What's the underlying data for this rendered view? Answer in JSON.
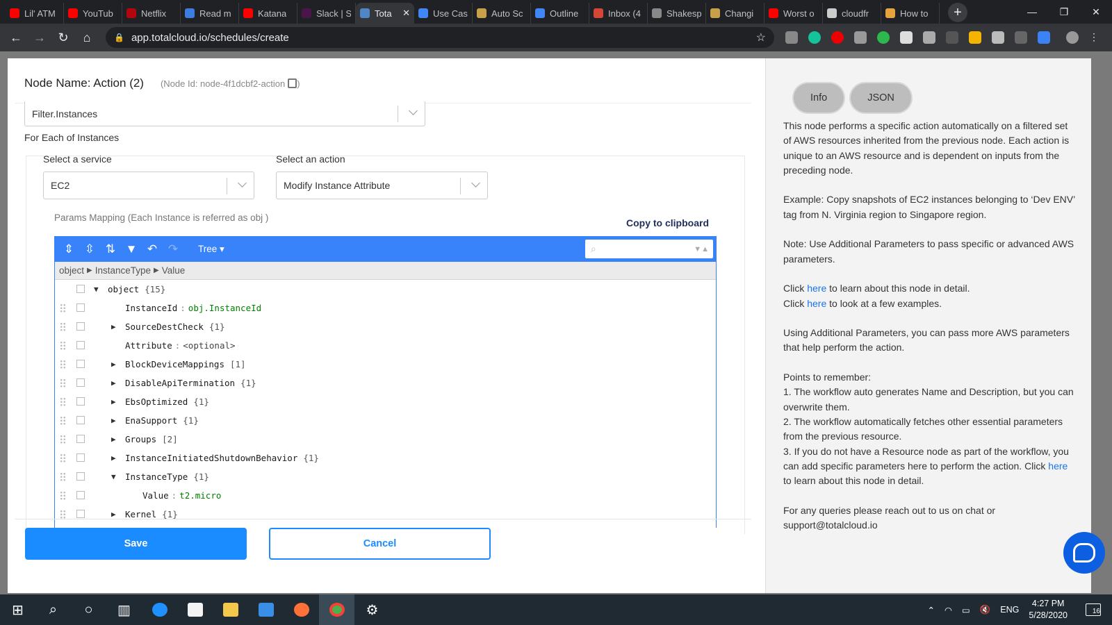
{
  "browser": {
    "tabs": [
      {
        "title": "Lil' ATM",
        "color": "#ff0000"
      },
      {
        "title": "YouTub",
        "color": "#ff0000"
      },
      {
        "title": "Netflix",
        "color": "#b1060f"
      },
      {
        "title": "Read m",
        "color": "#3d7de0"
      },
      {
        "title": "Katana",
        "color": "#ff0000"
      },
      {
        "title": "Slack | S",
        "color": "#4a154b"
      },
      {
        "title": "Tota",
        "color": "#4f86c6",
        "active": true
      },
      {
        "title": "Use Cas",
        "color": "#4285f4"
      },
      {
        "title": "Auto Sc",
        "color": "#c8a04a"
      },
      {
        "title": "Outline",
        "color": "#4285f4"
      },
      {
        "title": "Inbox (4",
        "color": "#d44638"
      },
      {
        "title": "Shakesp",
        "color": "#888888"
      },
      {
        "title": "Changi",
        "color": "#c8a04a"
      },
      {
        "title": "Worst o",
        "color": "#ff0000"
      },
      {
        "title": "cloudfr",
        "color": "#cccccc"
      },
      {
        "title": "How to",
        "color": "#e5a33d"
      }
    ],
    "url": "app.totalcloud.io/schedules/create"
  },
  "node": {
    "name": "Node Name: Action (2)",
    "id_text": "(Node Id: node-4f1dcbf2-action"
  },
  "form": {
    "filter_value": "Filter.Instances",
    "for_each_label": "For Each of Instances",
    "service_label": "Select a service",
    "service_value": "EC2",
    "action_label": "Select an action",
    "action_value": "Modify Instance Attribute",
    "params_label": "Params Mapping (Each Instance is referred as obj )",
    "copy_label": "Copy to clipboard"
  },
  "editor": {
    "mode": "Tree",
    "breadcrumb": [
      "object",
      "InstanceType",
      "Value"
    ],
    "rows": [
      {
        "key": "object",
        "count": "{15}",
        "level": 0,
        "toggle": "open"
      },
      {
        "key": "InstanceId",
        "value": "obj.InstanceId",
        "level": 1,
        "toggle": "none"
      },
      {
        "key": "SourceDestCheck",
        "count": "{1}",
        "level": 1,
        "toggle": "closed"
      },
      {
        "key": "Attribute",
        "value": "<optional>",
        "level": 1,
        "toggle": "none"
      },
      {
        "key": "BlockDeviceMappings",
        "count": "[1]",
        "level": 1,
        "toggle": "closed"
      },
      {
        "key": "DisableApiTermination",
        "count": "{1}",
        "level": 1,
        "toggle": "closed"
      },
      {
        "key": "EbsOptimized",
        "count": "{1}",
        "level": 1,
        "toggle": "closed"
      },
      {
        "key": "EnaSupport",
        "count": "{1}",
        "level": 1,
        "toggle": "closed"
      },
      {
        "key": "Groups",
        "count": "[2]",
        "level": 1,
        "toggle": "closed"
      },
      {
        "key": "InstanceInitiatedShutdownBehavior",
        "count": "{1}",
        "level": 1,
        "toggle": "closed"
      },
      {
        "key": "InstanceType",
        "count": "{1}",
        "level": 1,
        "toggle": "open"
      },
      {
        "key": "Value",
        "value": "t2.micro",
        "level": 2,
        "toggle": "none"
      },
      {
        "key": "Kernel",
        "count": "{1}",
        "level": 1,
        "toggle": "closed"
      }
    ]
  },
  "buttons": {
    "save": "Save",
    "cancel": "Cancel"
  },
  "info_panel": {
    "tabs": [
      "Info",
      "JSON"
    ],
    "p1": "This node performs a specific action automatically on a filtered set of AWS resources inherited from the previous node. Each action is unique to an AWS resource and is dependent on inputs from the preceding node.",
    "p2": "Example: Copy snapshots of EC2 instances belonging to ‘Dev ENV’ tag from N. Virginia region to Singapore region.",
    "p3": "Note: Use Additional Parameters to pass specific or advanced AWS parameters.",
    "click": "Click",
    "here": "here",
    "l1_rest": "to learn about this node in detail.",
    "l2_rest": "to look at a few examples.",
    "p5": "Using Additional Parameters, you can pass more AWS parameters that help perform the action.",
    "points_title": "Points to remember:",
    "pt1": "1. The workflow auto generates Name and Description, but you can overwrite them.",
    "pt2": "2. The workflow automatically fetches other essential parameters from the previous resource.",
    "pt3": "3. If you do not have a Resource node as part of the workflow, you can add specific parameters here to perform the action. Click",
    "pt3_rest": "to learn about this node in detail.",
    "p7": "For any queries please reach out to us on chat or support@totalcloud.io"
  },
  "taskbar": {
    "lang": "ENG",
    "time": "4:27 PM",
    "date": "5/28/2020",
    "notifications": "16"
  },
  "colors": {
    "primary": "#1a8cff",
    "editor": "#3883fa"
  }
}
